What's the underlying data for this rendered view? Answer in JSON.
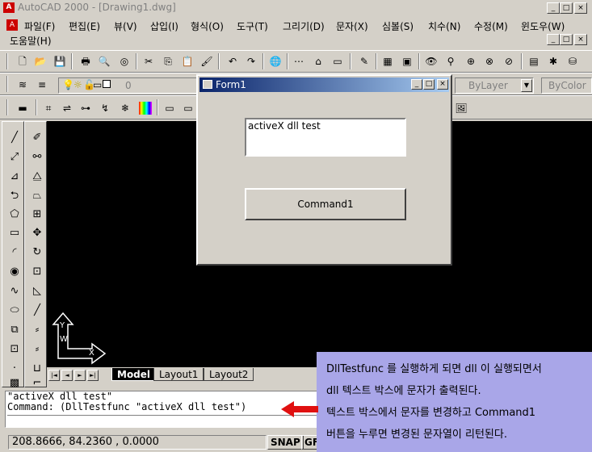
{
  "window": {
    "title": "AutoCAD 2000 - [Drawing1.dwg]",
    "min": "_",
    "max": "□",
    "close": "×"
  },
  "menu": {
    "items": [
      "파일(F)",
      "편집(E)",
      "뷰(V)",
      "삽입(I)",
      "형식(O)",
      "도구(T)",
      "그리기(D)",
      "문자(X)",
      "심볼(S)",
      "치수(N)",
      "수정(M)",
      "윈도우(W)"
    ],
    "help": "도움말(H)"
  },
  "layer": {
    "current": "0",
    "linetype": "ByLayer",
    "color": "ByColor"
  },
  "form": {
    "title": "Form1",
    "textbox_value": "activeX dll test",
    "button_label": "Command1"
  },
  "tabs": [
    "Model",
    "Layout1",
    "Layout2"
  ],
  "nav_arrows": [
    "|◄",
    "◄",
    "►",
    "►|"
  ],
  "command": {
    "line1": "\"activeX dll test\"",
    "line2": "Command: (DllTestfunc \"activeX dll test\")"
  },
  "status": {
    "coords": "208.8666, 84.2360 , 0.0000",
    "snap": "SNAP",
    "grid": "GF"
  },
  "ucs": {
    "y": "Y",
    "w": "W",
    "x": "X"
  },
  "annotation": {
    "line1": "DllTestfunc 를 실행하게 되면 dll 이 실행되면서",
    "line2": "dll 텍스트 박스에 문자가 출력된다.",
    "line3": "텍스트 박스에서 문자를 변경하고 Command1",
    "line4": "버튼을 누루면 변경된 문자열이 리턴된다."
  },
  "colors": {
    "canvas": "#000000",
    "annotation_bg": "#a9a6e8",
    "arrow": "#e01010",
    "titlebar": "#0a246a"
  }
}
